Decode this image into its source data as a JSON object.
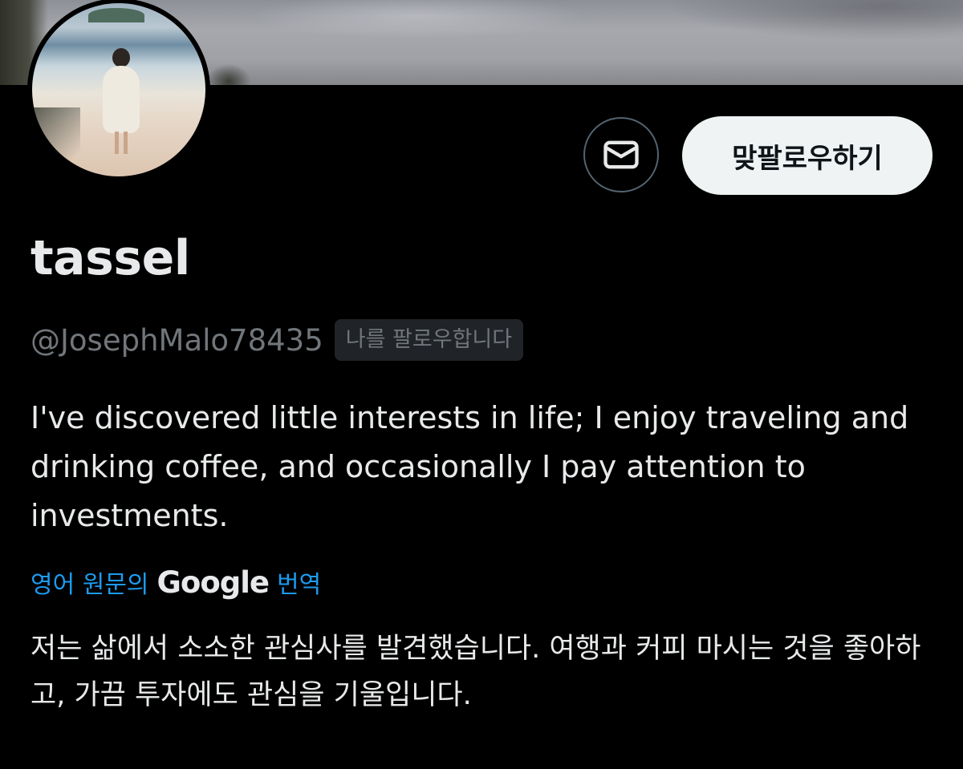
{
  "profile": {
    "display_name": "tassel",
    "handle": "@JosephMalo78435",
    "follows_you_badge": "나를 팔로우합니다",
    "bio": "I've discovered little interests in life; I enjoy traveling and drinking coffee, and occasionally I pay attention to investments."
  },
  "actions": {
    "message_icon": "envelope-icon",
    "follow_back_label": "맞팔로우하기"
  },
  "translation": {
    "label_prefix": "영어 원문의",
    "provider": "Google",
    "label_suffix": "번역",
    "translated_bio": "저는 삶에서 소소한 관심사를 발견했습니다. 여행과 커피 마시는 것을 좋아하고, 가끔 투자에도 관심을 기울입니다."
  },
  "colors": {
    "background": "#000000",
    "text_primary": "#e7e9ea",
    "text_secondary": "#71767b",
    "link": "#1d9bf0",
    "button_bg": "#eff3f4"
  }
}
